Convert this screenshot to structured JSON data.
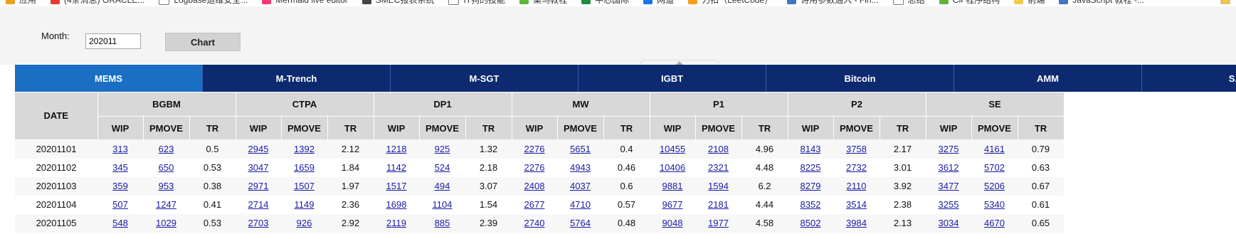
{
  "bookmarks": [
    {
      "label": "应用",
      "icon": "apps-icon",
      "color": "#e8a31a"
    },
    {
      "label": "(4条消息) ORACLE...",
      "icon": "csdn-icon",
      "color": "#e33b2e"
    },
    {
      "label": "Logbase运维安全...",
      "icon": "page-icon",
      "color": "#ffffff"
    },
    {
      "label": "Mermaid live editor",
      "icon": "mermaid-icon",
      "color": "#ff3670"
    },
    {
      "label": "SMEC报表系统",
      "icon": "report-icon",
      "color": "#444444"
    },
    {
      "label": "IT狗的技能",
      "icon": "page-icon",
      "color": "#ffffff"
    },
    {
      "label": "菜鸟教程",
      "icon": "runoob-icon",
      "color": "#5fb336"
    },
    {
      "label": "中芯国际",
      "icon": "smic-icon",
      "color": "#1e8e3e"
    },
    {
      "label": "网道",
      "icon": "wangdoc-icon",
      "color": "#1a73e8"
    },
    {
      "label": "力扣（LeetCode）",
      "icon": "leetcode-icon",
      "color": "#f89f1b"
    },
    {
      "label": "诗用参数通入 - Fin...",
      "icon": "doc-icon",
      "color": "#4472c4"
    },
    {
      "label": "总结",
      "icon": "page-icon",
      "color": "#ffffff"
    },
    {
      "label": "C# 程序结构",
      "icon": "runoob-icon",
      "color": "#5fb336"
    },
    {
      "label": "前端",
      "icon": "folder-icon",
      "color": "#f2c94c"
    },
    {
      "label": "JavaScript 教程 -...",
      "icon": "doc-icon",
      "color": "#4472c4"
    }
  ],
  "filter": {
    "month_label": "Month:",
    "month_value": "202011",
    "chart_button": "Chart"
  },
  "tabs": [
    {
      "label": "MEMS",
      "active": true
    },
    {
      "label": "M-Trench",
      "active": false
    },
    {
      "label": "M-SGT",
      "active": false
    },
    {
      "label": "IGBT",
      "active": false
    },
    {
      "label": "Bitcoin",
      "active": false
    },
    {
      "label": "AMM",
      "active": false
    },
    {
      "label": "S...",
      "active": false
    }
  ],
  "table": {
    "date_header": "DATE",
    "groups": [
      "BGBM",
      "CTPA",
      "DP1",
      "MW",
      "P1",
      "P2",
      "SE"
    ],
    "sub_headers": [
      "WIP",
      "PMOVE",
      "TR"
    ],
    "rows": [
      {
        "date": "20201101",
        "cells": [
          [
            "313",
            "623",
            "0.5"
          ],
          [
            "2945",
            "1392",
            "2.12"
          ],
          [
            "1218",
            "925",
            "1.32"
          ],
          [
            "2276",
            "5651",
            "0.4"
          ],
          [
            "10455",
            "2108",
            "4.96"
          ],
          [
            "8143",
            "3758",
            "2.17"
          ],
          [
            "3275",
            "4161",
            "0.79"
          ]
        ]
      },
      {
        "date": "20201102",
        "cells": [
          [
            "345",
            "650",
            "0.53"
          ],
          [
            "3047",
            "1659",
            "1.84"
          ],
          [
            "1142",
            "524",
            "2.18"
          ],
          [
            "2276",
            "4943",
            "0.46"
          ],
          [
            "10406",
            "2321",
            "4.48"
          ],
          [
            "8225",
            "2732",
            "3.01"
          ],
          [
            "3612",
            "5702",
            "0.63"
          ]
        ]
      },
      {
        "date": "20201103",
        "cells": [
          [
            "359",
            "953",
            "0.38"
          ],
          [
            "2971",
            "1507",
            "1.97"
          ],
          [
            "1517",
            "494",
            "3.07"
          ],
          [
            "2408",
            "4037",
            "0.6"
          ],
          [
            "9881",
            "1594",
            "6.2"
          ],
          [
            "8279",
            "2110",
            "3.92"
          ],
          [
            "3477",
            "5206",
            "0.67"
          ]
        ]
      },
      {
        "date": "20201104",
        "cells": [
          [
            "507",
            "1247",
            "0.41"
          ],
          [
            "2714",
            "1149",
            "2.36"
          ],
          [
            "1698",
            "1104",
            "1.54"
          ],
          [
            "2677",
            "4710",
            "0.57"
          ],
          [
            "9677",
            "2181",
            "4.44"
          ],
          [
            "8352",
            "3514",
            "2.38"
          ],
          [
            "3255",
            "5340",
            "0.61"
          ]
        ]
      },
      {
        "date": "20201105",
        "cells": [
          [
            "548",
            "1029",
            "0.53"
          ],
          [
            "2703",
            "926",
            "2.92"
          ],
          [
            "2119",
            "885",
            "2.39"
          ],
          [
            "2740",
            "5764",
            "0.48"
          ],
          [
            "9048",
            "1977",
            "4.58"
          ],
          [
            "8502",
            "3984",
            "2.13"
          ],
          [
            "3034",
            "4670",
            "0.65"
          ]
        ]
      }
    ]
  },
  "colors": {
    "tab_active": "#1a6fc4",
    "tab_inactive": "#0d2a70",
    "header_bg": "#d8d8d8",
    "link": "#1a1aa6"
  }
}
